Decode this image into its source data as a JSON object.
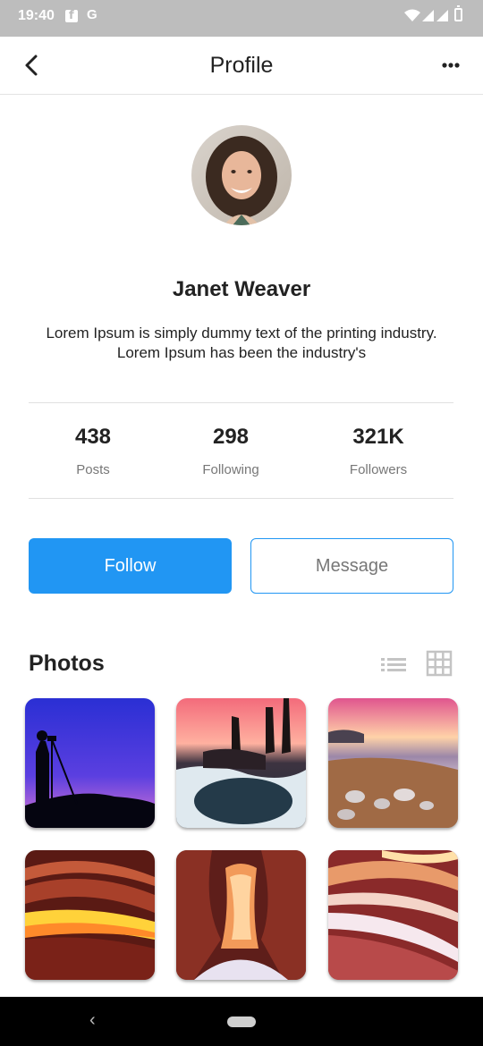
{
  "status_bar": {
    "time": "19:40",
    "g_label": "G"
  },
  "app_bar": {
    "title": "Profile"
  },
  "profile": {
    "name": "Janet Weaver",
    "bio": "Lorem Ipsum is simply dummy text of the printing industry. Lorem Ipsum has been the industry's"
  },
  "stats": [
    {
      "value": "438",
      "label": "Posts"
    },
    {
      "value": "298",
      "label": "Following"
    },
    {
      "value": "321K",
      "label": "Followers"
    }
  ],
  "actions": {
    "follow_label": "Follow",
    "message_label": "Message"
  },
  "photos": {
    "title": "Photos"
  },
  "navigation": {
    "back_glyph": "‹"
  },
  "colors": {
    "accent": "#2196f3",
    "status_bar": "#bdbdbd",
    "nav_bar": "#000000"
  }
}
